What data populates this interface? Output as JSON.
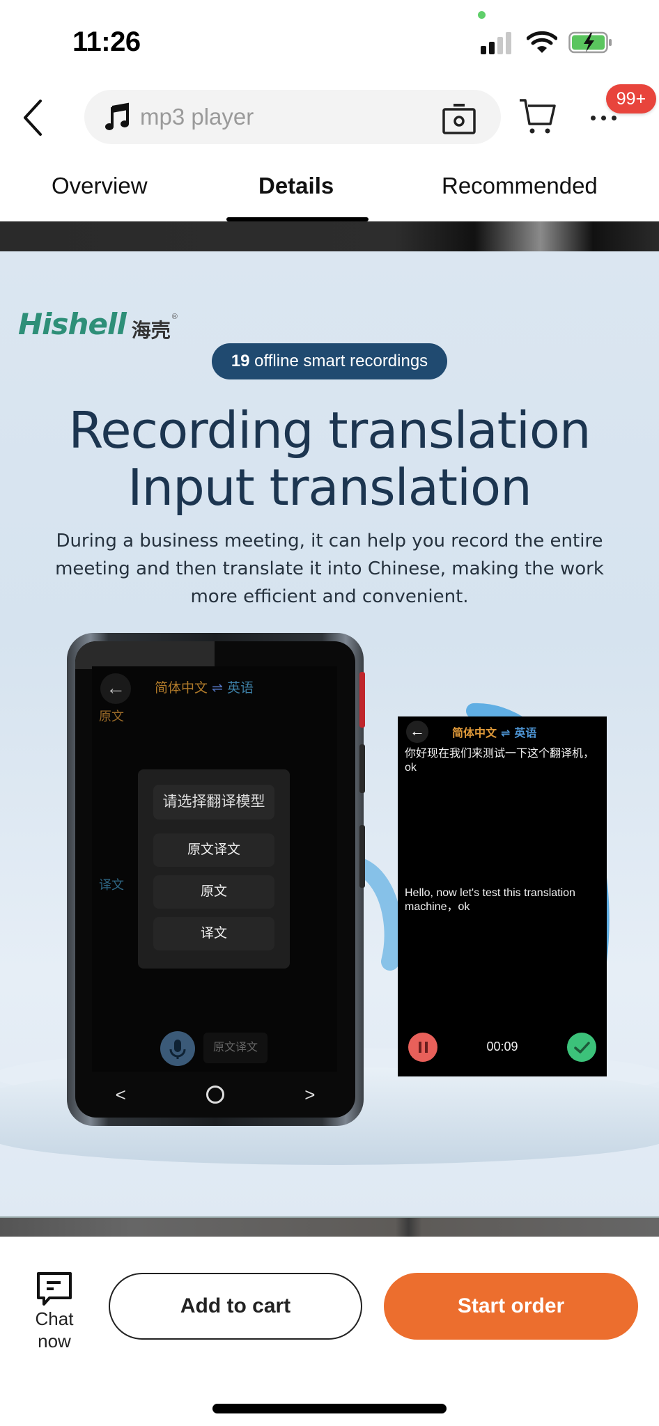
{
  "status_bar": {
    "time": "11:26",
    "icons": [
      "camera-indicator-dot",
      "cellular-signal-icon",
      "wifi-icon",
      "battery-charging-icon"
    ]
  },
  "header": {
    "back_icon": "chevron-left-icon",
    "search": {
      "icon": "music-note-icon",
      "value": "mp3 player",
      "camera_icon": "image-search-camera-icon"
    },
    "cart_icon": "cart-icon",
    "more_icon": "more-dots-icon",
    "notification_badge": "99+"
  },
  "tabs": [
    {
      "label": "Overview",
      "active": false
    },
    {
      "label": "Details",
      "active": true
    },
    {
      "label": "Recommended",
      "active": false
    }
  ],
  "product_image": {
    "brand_en": "Hishell",
    "brand_cn": "海壳",
    "brand_reg": "®",
    "pill": {
      "number": "19",
      "text": " offline smart recordings"
    },
    "headline_line1": "Recording translation",
    "headline_line2": "Input translation",
    "description": "During a business meeting, it can help you record the entire meeting and then translate it into Chinese, making the work more efficient and convenient.",
    "device_screen": {
      "lang_source": "简体中文",
      "lang_swap": "⇌",
      "lang_target": "英语",
      "original_label": "原文",
      "translation_label": "译文",
      "modal_title": "请选择翻译模型",
      "modal_options": [
        "原文译文",
        "原文",
        "译文"
      ],
      "mode_chip": "原文译文",
      "nav": {
        "prev": "<",
        "next": ">"
      }
    },
    "recording_card": {
      "lang_source": "简体中文",
      "lang_swap": "⇌",
      "lang_target": "英语",
      "chinese_text": "你好现在我们来测试一下这个翻译机，ok",
      "english_text": "Hello, now let's test this translation machine，ok",
      "timer": "00:09"
    }
  },
  "action_bar": {
    "chat_label_line1": "Chat",
    "chat_label_line2": "now",
    "add_to_cart": "Add to cart",
    "start_order": "Start order"
  },
  "colors": {
    "accent_orange": "#ec6e2e",
    "badge_red": "#e8443c",
    "brand_green": "#2e8f78",
    "pill_navy": "#204a70"
  }
}
